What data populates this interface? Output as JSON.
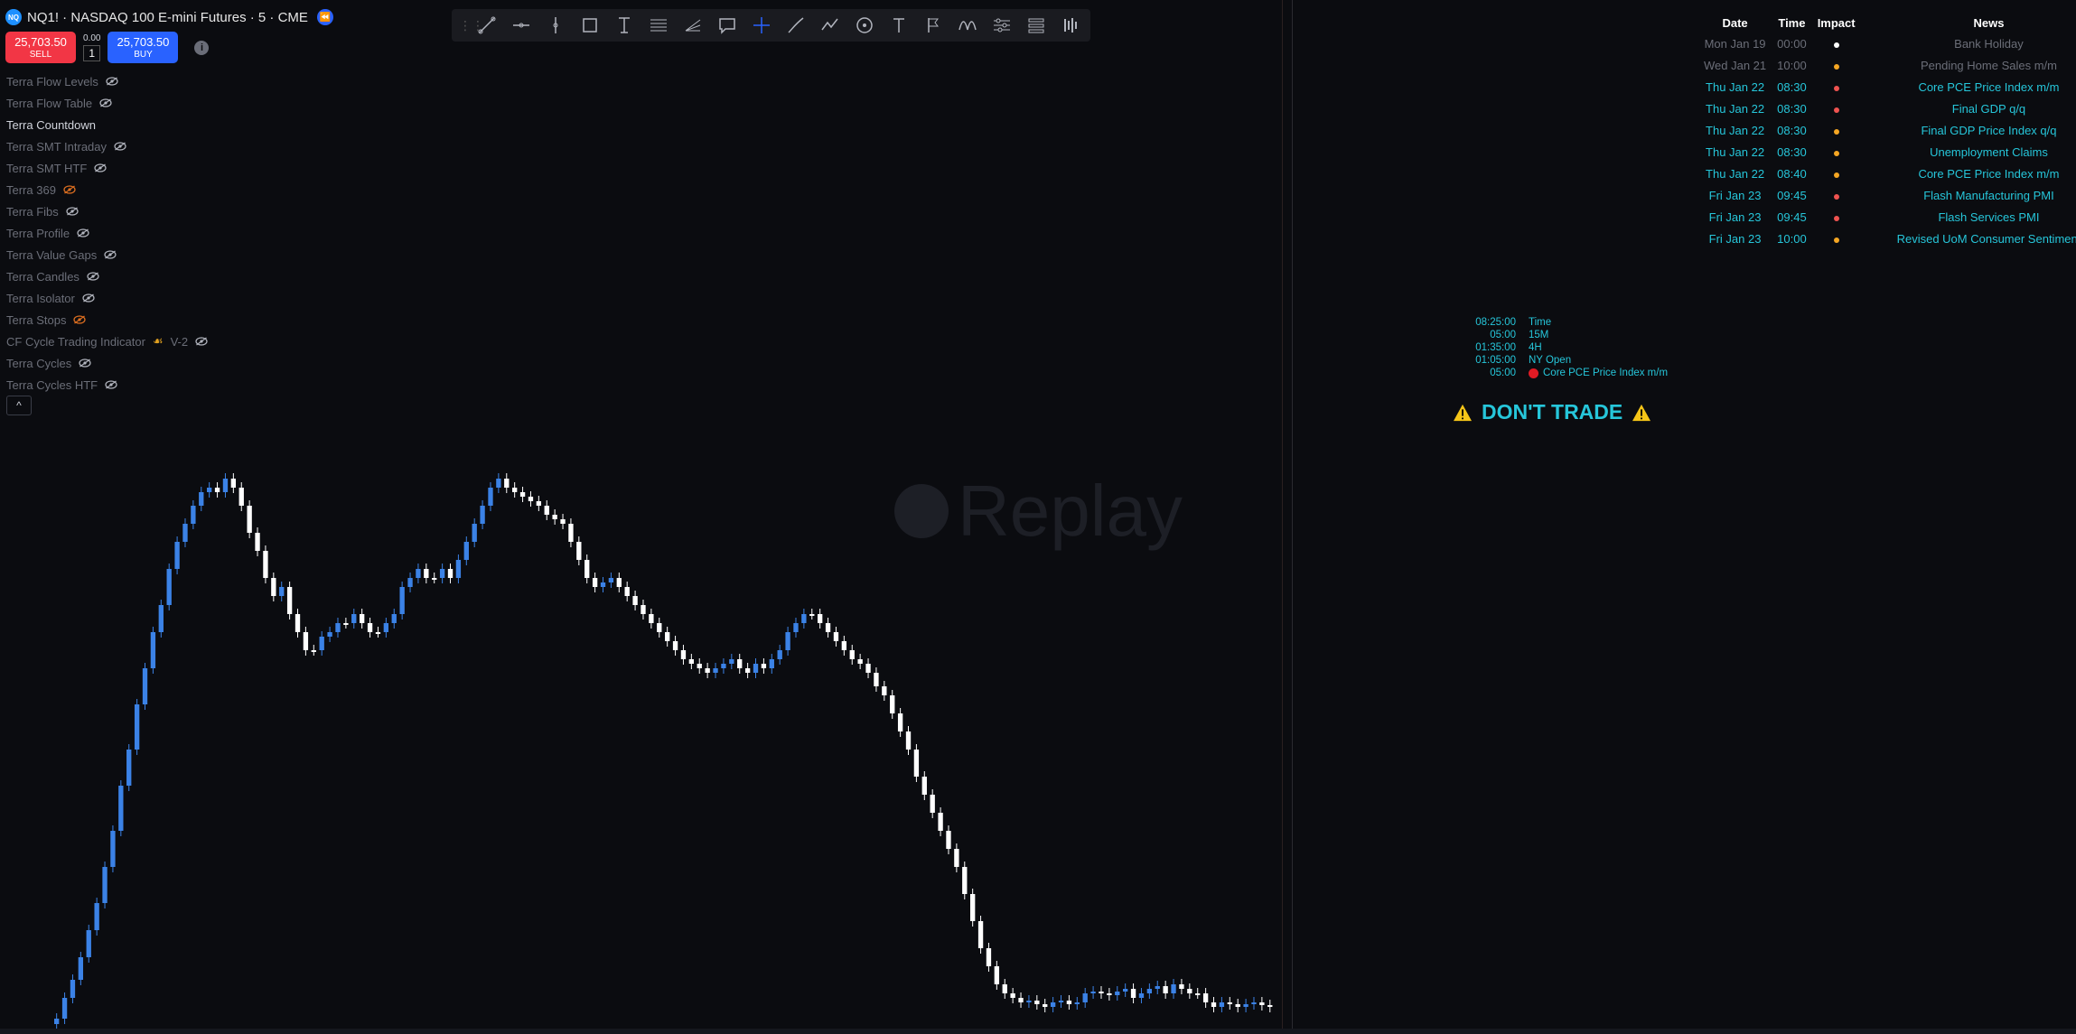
{
  "header": {
    "symbol_logo": "NQ",
    "title": "NQ1! · NASDAQ 100 E-mini Futures · 5 · CME",
    "replay_icon": "replay-icon"
  },
  "order": {
    "sell_price": "25,703.50",
    "sell_label": "SELL",
    "spread": "0.00",
    "quantity": "1",
    "buy_price": "25,703.50",
    "buy_label": "BUY",
    "info_glyph": "i"
  },
  "indicators": [
    {
      "name": "Terra Flow Levels",
      "active": false
    },
    {
      "name": "Terra Flow Table",
      "active": false
    },
    {
      "name": "Terra Countdown",
      "active": true
    },
    {
      "name": "Terra SMT Intraday",
      "active": false
    },
    {
      "name": "Terra SMT HTF",
      "active": false
    },
    {
      "name": "Terra 369",
      "active": false,
      "eye_color": "#e07020"
    },
    {
      "name": "Terra Fibs",
      "active": false
    },
    {
      "name": "Terra Profile",
      "active": false
    },
    {
      "name": "Terra Value Gaps",
      "active": false
    },
    {
      "name": "Terra Candles",
      "active": false
    },
    {
      "name": "Terra Isolator",
      "active": false
    },
    {
      "name": "Terra Stops",
      "active": false,
      "eye_color": "#e07020"
    },
    {
      "name": "CF Cycle Trading Indicator",
      "active": false,
      "suffix": "V-2"
    },
    {
      "name": "Terra Cycles",
      "active": false
    },
    {
      "name": "Terra Cycles HTF",
      "active": false
    }
  ],
  "collapse_glyph": "^",
  "toolbar_tools": [
    "trend-line-icon",
    "horizontal-line-icon",
    "vertical-line-icon",
    "rectangle-icon",
    "text-cursor-icon",
    "fib-retracement-icon",
    "pitchfork-icon",
    "callout-icon",
    "crosshair-icon",
    "brush-icon",
    "path-icon",
    "circle-icon",
    "text-icon",
    "long-position-icon",
    "cycle-lines-icon",
    "sliders-icon",
    "settings-list-icon",
    "bar-pattern-icon"
  ],
  "watermark": "Replay",
  "news": {
    "headers": {
      "date": "Date",
      "time": "Time",
      "impact": "Impact",
      "news": "News"
    },
    "rows": [
      {
        "date": "Mon Jan 19",
        "time": "00:00",
        "impact_color": "#ffffff",
        "news": "Bank Holiday",
        "past": true
      },
      {
        "date": "Wed Jan 21",
        "time": "10:00",
        "impact_color": "#f5a623",
        "news": "Pending Home Sales m/m",
        "past": true
      },
      {
        "date": "Thu Jan 22",
        "time": "08:30",
        "impact_color": "#ef5350",
        "news": "Core PCE Price Index m/m",
        "past": false
      },
      {
        "date": "Thu Jan 22",
        "time": "08:30",
        "impact_color": "#ef5350",
        "news": "Final GDP q/q",
        "past": false
      },
      {
        "date": "Thu Jan 22",
        "time": "08:30",
        "impact_color": "#f5a623",
        "news": "Final GDP Price Index q/q",
        "past": false
      },
      {
        "date": "Thu Jan 22",
        "time": "08:30",
        "impact_color": "#f5a623",
        "news": "Unemployment Claims",
        "past": false
      },
      {
        "date": "Thu Jan 22",
        "time": "08:40",
        "impact_color": "#f5a623",
        "news": "Core PCE Price Index m/m",
        "past": false
      },
      {
        "date": "Fri Jan 23",
        "time": "09:45",
        "impact_color": "#ef5350",
        "news": "Flash Manufacturing PMI",
        "past": false
      },
      {
        "date": "Fri Jan 23",
        "time": "09:45",
        "impact_color": "#ef5350",
        "news": "Flash Services PMI",
        "past": false
      },
      {
        "date": "Fri Jan 23",
        "time": "10:00",
        "impact_color": "#f5a623",
        "news": "Revised UoM Consumer Sentiment",
        "past": false
      }
    ]
  },
  "countdown": [
    {
      "value": "08:25:00",
      "label": "Time"
    },
    {
      "value": "05:00",
      "label": "15M"
    },
    {
      "value": "01:35:00",
      "label": "4H"
    },
    {
      "value": "01:05:00",
      "label": "NY Open"
    },
    {
      "value": "05:00",
      "label": "Core PCE Price Index m/m",
      "dot": true
    }
  ],
  "dont_trade": "DON'T TRADE",
  "colors": {
    "up_candle": "#3b82e6",
    "down_candle": "#ffffff",
    "accent_cyan": "#26c6da",
    "sell": "#f23645",
    "buy": "#2962ff"
  },
  "chart_data": {
    "type": "candlestick",
    "description_series": "close",
    "closes": [
      1128,
      1105,
      1085,
      1060,
      1030,
      1000,
      960,
      920,
      870,
      830,
      780,
      740,
      700,
      670,
      630,
      600,
      580,
      560,
      545,
      540,
      545,
      530,
      540,
      560,
      590,
      610,
      640,
      660,
      650,
      680,
      700,
      720,
      720,
      705,
      700,
      690,
      690,
      680,
      690,
      700,
      700,
      690,
      680,
      650,
      640,
      630,
      640,
      640,
      630,
      640,
      620,
      600,
      580,
      560,
      540,
      530,
      540,
      545,
      550,
      555,
      560,
      570,
      575,
      580,
      600,
      620,
      640,
      650,
      645,
      640,
      650,
      660,
      670,
      680,
      690,
      700,
      710,
      720,
      730,
      735,
      740,
      745,
      740,
      735,
      730,
      740,
      745,
      735,
      740,
      730,
      720,
      700,
      690,
      680,
      680,
      690,
      700,
      710,
      720,
      730,
      735,
      745,
      760,
      770,
      790,
      810,
      830,
      860,
      880,
      900,
      920,
      940,
      960,
      990,
      1020,
      1050,
      1070,
      1090,
      1100,
      1105,
      1110,
      1108,
      1112,
      1115,
      1110,
      1108,
      1112,
      1110,
      1100,
      1098,
      1100,
      1102,
      1098,
      1095,
      1105,
      1100,
      1095,
      1092,
      1100,
      1090,
      1095,
      1100,
      1100,
      1110,
      1115,
      1110,
      1112,
      1115,
      1112,
      1110,
      1113,
      1115
    ]
  }
}
